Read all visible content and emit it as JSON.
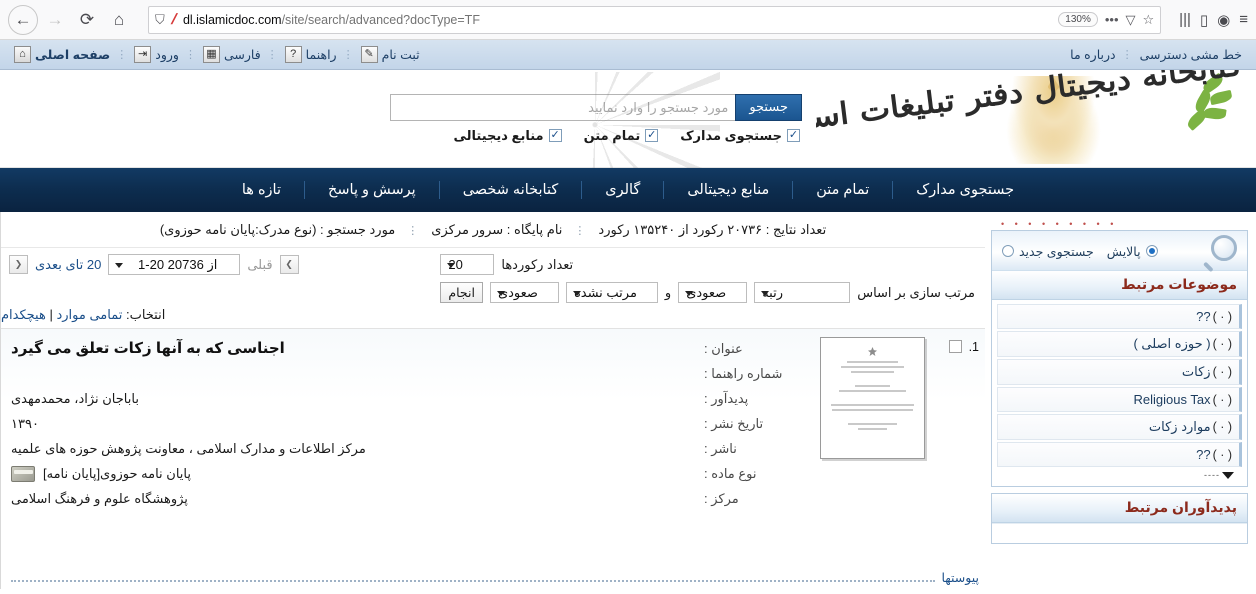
{
  "browser": {
    "back_icon": "←",
    "forward_icon": "→",
    "reload_icon": "⟳",
    "home_icon": "⌂",
    "shield_icon": "shield",
    "url_prefix": "dl.islamicdoc.com",
    "url_suffix": "/site/search/advanced?docType=TF",
    "zoom_level": "130%",
    "menu_icon": "•••",
    "pocket_icon": "▽",
    "bookmark_icon": "☆",
    "library_icon": "|||",
    "sidebar_icon": "▯",
    "account_icon": "◉",
    "appmenu_icon": "≡"
  },
  "topbar": {
    "left_items": [
      {
        "label": "صفحه اصلی",
        "icon": "home-icon",
        "glyph": "⌂",
        "bold": true
      },
      {
        "label": "ورود",
        "icon": "login-icon",
        "glyph": "⇥",
        "bold": false
      },
      {
        "label": "فارسی",
        "icon": "language-icon",
        "glyph": "▦",
        "bold": false
      },
      {
        "label": "راهنما",
        "icon": "help-icon",
        "glyph": "?",
        "bold": false
      },
      {
        "label": "ثبت نام",
        "icon": "register-icon",
        "glyph": "✎",
        "bold": false
      }
    ],
    "right_items": [
      {
        "label": "خط مشی دسترسی"
      },
      {
        "label": "درباره ما"
      }
    ]
  },
  "banner": {
    "logo_text": "کتابخانه دیجیتال دفتر تبلیغات اسلامی",
    "search": {
      "button_label": "جستجو",
      "placeholder": "مورد جستجو را وارد نمایید",
      "value": "",
      "checkboxes": [
        {
          "label": "جستجوی مدارک",
          "checked": true
        },
        {
          "label": "تمام متن",
          "checked": true
        },
        {
          "label": "منابع دیجیتالی",
          "checked": true
        }
      ],
      "check_glyph": "✓"
    }
  },
  "mainnav": {
    "items": [
      {
        "label": "جستجوی مدارک"
      },
      {
        "label": "تمام متن"
      },
      {
        "label": "منابع دیجیتالی"
      },
      {
        "label": "گالری"
      },
      {
        "label": "کتابخانه شخصی"
      },
      {
        "label": "پرسش و پاسخ"
      },
      {
        "label": "تازه ها"
      }
    ]
  },
  "results": {
    "info": {
      "query_label": "مورد جستجو : (نوع مدرک:پایان نامه حوزوی)",
      "database_label": "نام پایگاه : سرور مرکزی",
      "count_label": "تعداد نتایج : ۲۰۷۳۶ رکورد از ۱۳۵۲۴۰ رکورد"
    },
    "pager": {
      "prev_arrow": "❯",
      "prev_label": "قبلی",
      "range_label": "1-20 از 20736",
      "next_label": "20 تای بعدی",
      "next_arrow": "❮"
    },
    "sort": {
      "records_label": "تعداد رکوردها",
      "records_value": "20",
      "sortby_label": "مرتب سازی بر اساس",
      "field1": "رتبه",
      "dir1": "صعودی",
      "conjunction": "و",
      "field2": "مرتب نشده",
      "dir2": "صعودی",
      "apply_label": "انجام"
    },
    "selection": {
      "prefix": "انتخاب:",
      "all_label": "تمامی موارد",
      "separator": "|",
      "none_label": "هیچکدام"
    },
    "record": {
      "number": ".1",
      "checked": false,
      "fields": [
        {
          "label": "عنوان :",
          "value": "اجناسی که به آنها زکات تعلق می گیرد",
          "is_title": true
        },
        {
          "label": "شماره راهنما :",
          "value": "",
          "is_title": false
        },
        {
          "label": "پدیدآور :",
          "value": "باباجان نژاد، محمدمهدی",
          "is_title": false
        },
        {
          "label": "تاریخ نشر :",
          "value": "۱۳۹۰",
          "is_title": false
        },
        {
          "label": "ناشر :",
          "value": "مرکز اطلاعات و مدارک اسلامی ، معاونت پژوهش حوزه های علمیه",
          "is_title": false
        },
        {
          "label": "نوع ماده :",
          "value": "پایان نامه حوزوی[پایان نامه]",
          "is_title": false,
          "has_media_icon": true
        },
        {
          "label": "مرکز :",
          "value": "پژوهشگاه علوم و فرهنگ اسلامی",
          "is_title": false
        }
      ],
      "attachments_label": "پیوستها"
    }
  },
  "sidebar": {
    "mode": {
      "new_search_label": "جستجوی جدید",
      "new_search_selected": false,
      "refine_label": "پالایش",
      "refine_selected": true
    },
    "panels": [
      {
        "title": "موضوعات مرتبط",
        "facets": [
          {
            "label": "??",
            "count": "( · )"
          },
          {
            "label": "( حوزه اصلی )",
            "count": "( · )"
          },
          {
            "label": "زکات",
            "count": "( · )"
          },
          {
            "label": "Religious Tax",
            "count": "( · )"
          },
          {
            "label": "موارد زکات",
            "count": "( · )"
          },
          {
            "label": "??",
            "count": "( · )"
          }
        ],
        "more_dashes": "----"
      },
      {
        "title": "پدیدآوران مرتبط",
        "facets": [],
        "more_dashes": ""
      }
    ]
  },
  "colors": {
    "nav_dark": "#0d2d4f",
    "accent_blue": "#1b5590",
    "panel_title_red": "#8c2a1c",
    "link_blue": "#1b4f8a"
  }
}
